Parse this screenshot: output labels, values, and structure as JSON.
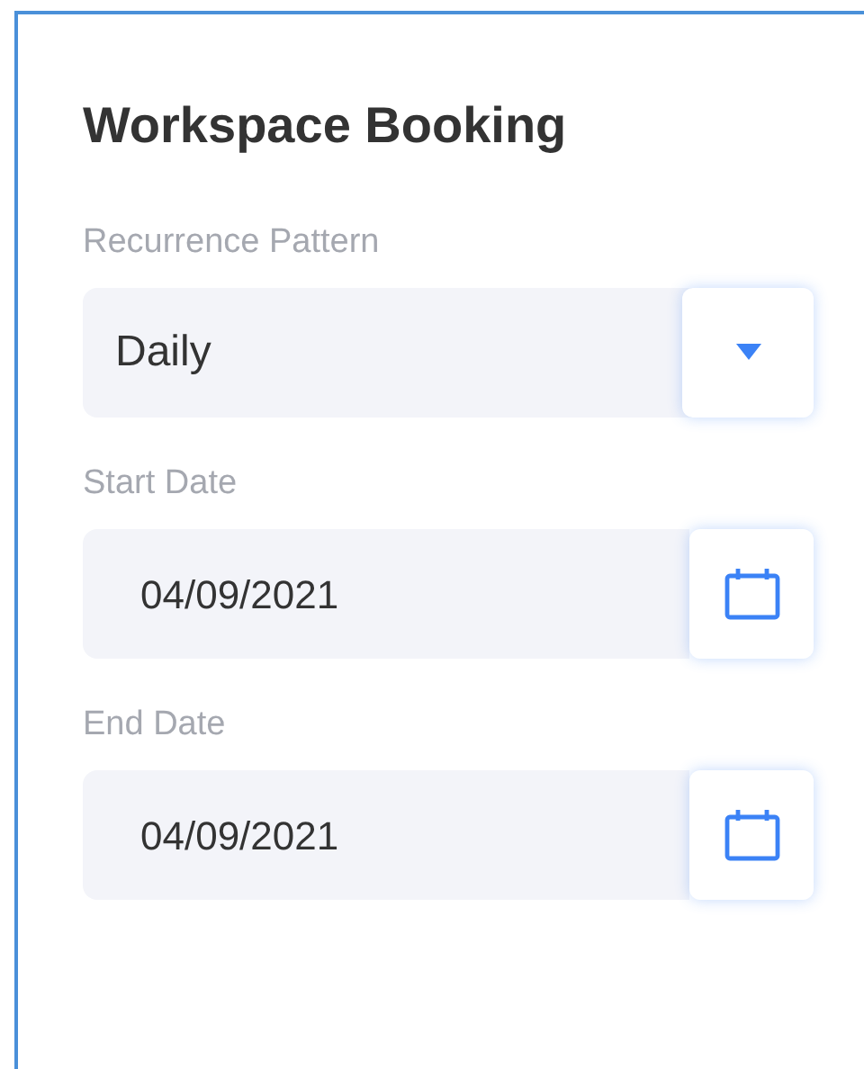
{
  "title": "Workspace Booking",
  "fields": [
    {
      "kind": "select",
      "label": "Recurrence Pattern",
      "value": "Daily"
    },
    {
      "kind": "date",
      "label": "Start Date",
      "value": "04/09/2021"
    },
    {
      "kind": "date",
      "label": "End Date",
      "value": "04/09/2021"
    }
  ]
}
